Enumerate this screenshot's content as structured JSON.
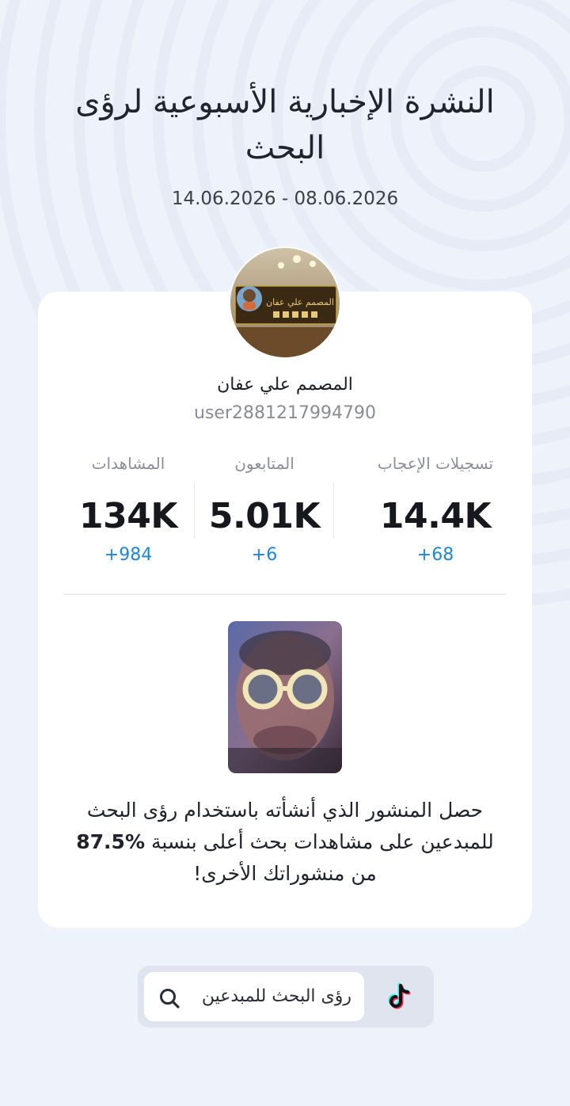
{
  "header": {
    "title": "النشرة الإخبارية الأسبوعية لرؤى البحث",
    "date_range": "14.06.2026 - 08.06.2026"
  },
  "profile": {
    "display_name": "المصمم علي عفان",
    "username": "user2881217994790",
    "avatar_plaque_text": "المصمم علي عفان"
  },
  "stats": [
    {
      "label": "تسجيلات الإعجاب",
      "value": "14.4K",
      "delta": "68+"
    },
    {
      "label": "المتابعون",
      "value": "5.01K",
      "delta": "6+"
    },
    {
      "label": "المشاهدات",
      "value": "134K",
      "delta": "984+"
    }
  ],
  "promo": {
    "text_before": "حصل المنشور الذي أنشأته باستخدام رؤى البحث للمبدعين على مشاهدات بحث أعلى بنسبة",
    "percent": "%87.5",
    "text_after": "من منشوراتك الأخرى!"
  },
  "search": {
    "label": "رؤى البحث للمبدعين",
    "icon": "search-icon"
  },
  "brand": {
    "icon": "tiktok-logo-icon"
  },
  "colors": {
    "background": "#eef2fb",
    "card": "#ffffff",
    "delta_blue": "#1e86d6",
    "tiktok_cyan": "#25f4ee",
    "tiktok_red": "#fe2c55"
  }
}
